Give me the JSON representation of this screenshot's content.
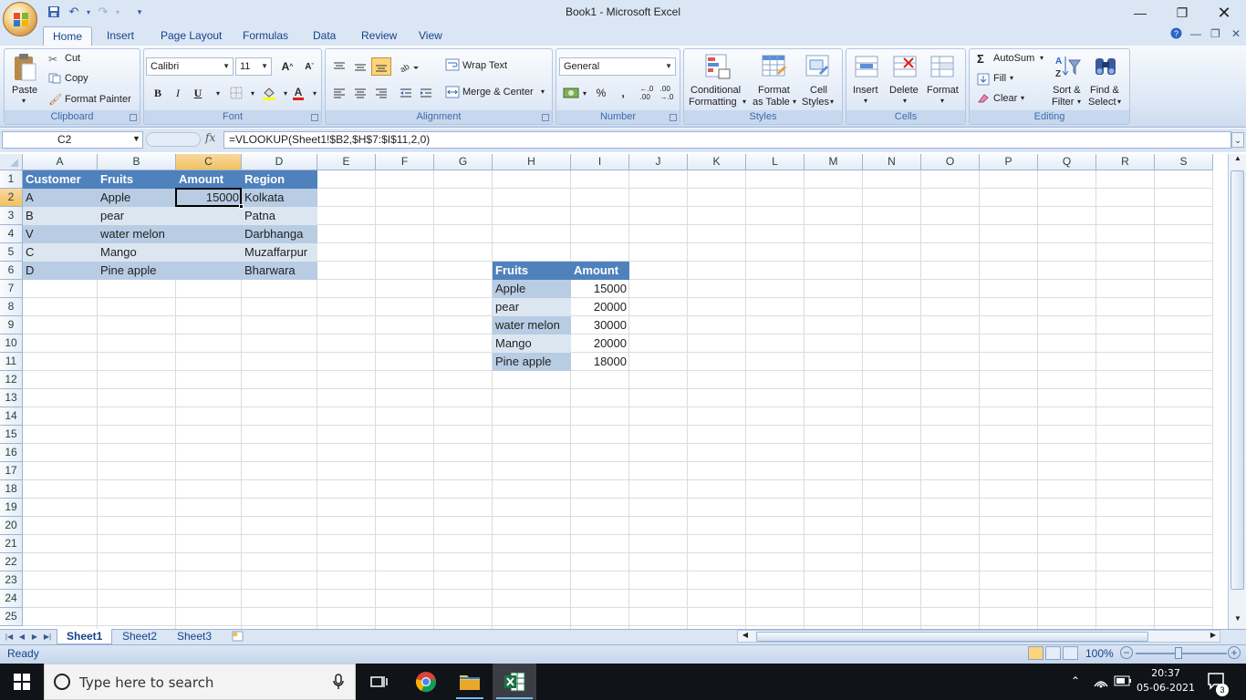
{
  "window": {
    "title": "Book1 - Microsoft Excel"
  },
  "ribbon_tabs": [
    "Home",
    "Insert",
    "Page Layout",
    "Formulas",
    "Data",
    "Review",
    "View"
  ],
  "clipboard": {
    "paste": "Paste",
    "cut": "Cut",
    "copy": "Copy",
    "format_painter": "Format Painter",
    "label": "Clipboard"
  },
  "font": {
    "name": "Calibri",
    "size": "11",
    "label": "Font",
    "bold": "B",
    "italic": "I",
    "underline": "U"
  },
  "alignment": {
    "wrap": "Wrap Text",
    "merge": "Merge & Center",
    "label": "Alignment"
  },
  "number": {
    "format": "General",
    "percent": "%",
    "comma": ",",
    "label": "Number"
  },
  "styles": {
    "conditional_1": "Conditional",
    "conditional_2": "Formatting",
    "table_1": "Format",
    "table_2": "as Table",
    "cell_1": "Cell",
    "cell_2": "Styles",
    "label": "Styles"
  },
  "cells": {
    "insert": "Insert",
    "delete": "Delete",
    "format": "Format",
    "label": "Cells"
  },
  "editing": {
    "autosum": "AutoSum",
    "fill": "Fill",
    "clear": "Clear",
    "sort_1": "Sort &",
    "sort_2": "Filter",
    "find_1": "Find &",
    "find_2": "Select",
    "label": "Editing"
  },
  "formula_bar": {
    "name_box": "C2",
    "fx": "fx",
    "formula": "=VLOOKUP(Sheet1!$B2,$H$7:$I$11,2,0)"
  },
  "columns": [
    "A",
    "B",
    "C",
    "D",
    "E",
    "F",
    "G",
    "H",
    "I",
    "J",
    "K",
    "L",
    "M",
    "N",
    "O",
    "P",
    "Q",
    "R",
    "S"
  ],
  "rows": [
    "1",
    "2",
    "3",
    "4",
    "5",
    "6",
    "7",
    "8",
    "9",
    "10",
    "11",
    "12",
    "13",
    "14",
    "15",
    "16",
    "17",
    "18",
    "19",
    "20",
    "21",
    "22",
    "23",
    "24",
    "25"
  ],
  "table1": {
    "headers": [
      "Customer",
      "Fruits",
      "Amount",
      "Region"
    ],
    "rows": [
      [
        "A",
        "Apple",
        "15000",
        "Kolkata"
      ],
      [
        "B",
        "pear",
        "",
        "Patna"
      ],
      [
        "V",
        "water melon",
        "",
        "Darbhanga"
      ],
      [
        "C",
        "Mango",
        "",
        "Muzaffarpur"
      ],
      [
        "D",
        "Pine apple",
        "",
        "Bharwara"
      ]
    ]
  },
  "table2": {
    "headers": [
      "Fruits",
      "Amount"
    ],
    "rows": [
      [
        "Apple",
        "15000"
      ],
      [
        "pear",
        "20000"
      ],
      [
        "water melon",
        "30000"
      ],
      [
        "Mango",
        "20000"
      ],
      [
        "Pine apple",
        "18000"
      ]
    ]
  },
  "sheets": [
    "Sheet1",
    "Sheet2",
    "Sheet3"
  ],
  "status": {
    "ready": "Ready",
    "zoom": "100%"
  },
  "taskbar": {
    "search_placeholder": "Type here to search",
    "time": "20:37",
    "date": "05-06-2021",
    "notifications": "3"
  }
}
